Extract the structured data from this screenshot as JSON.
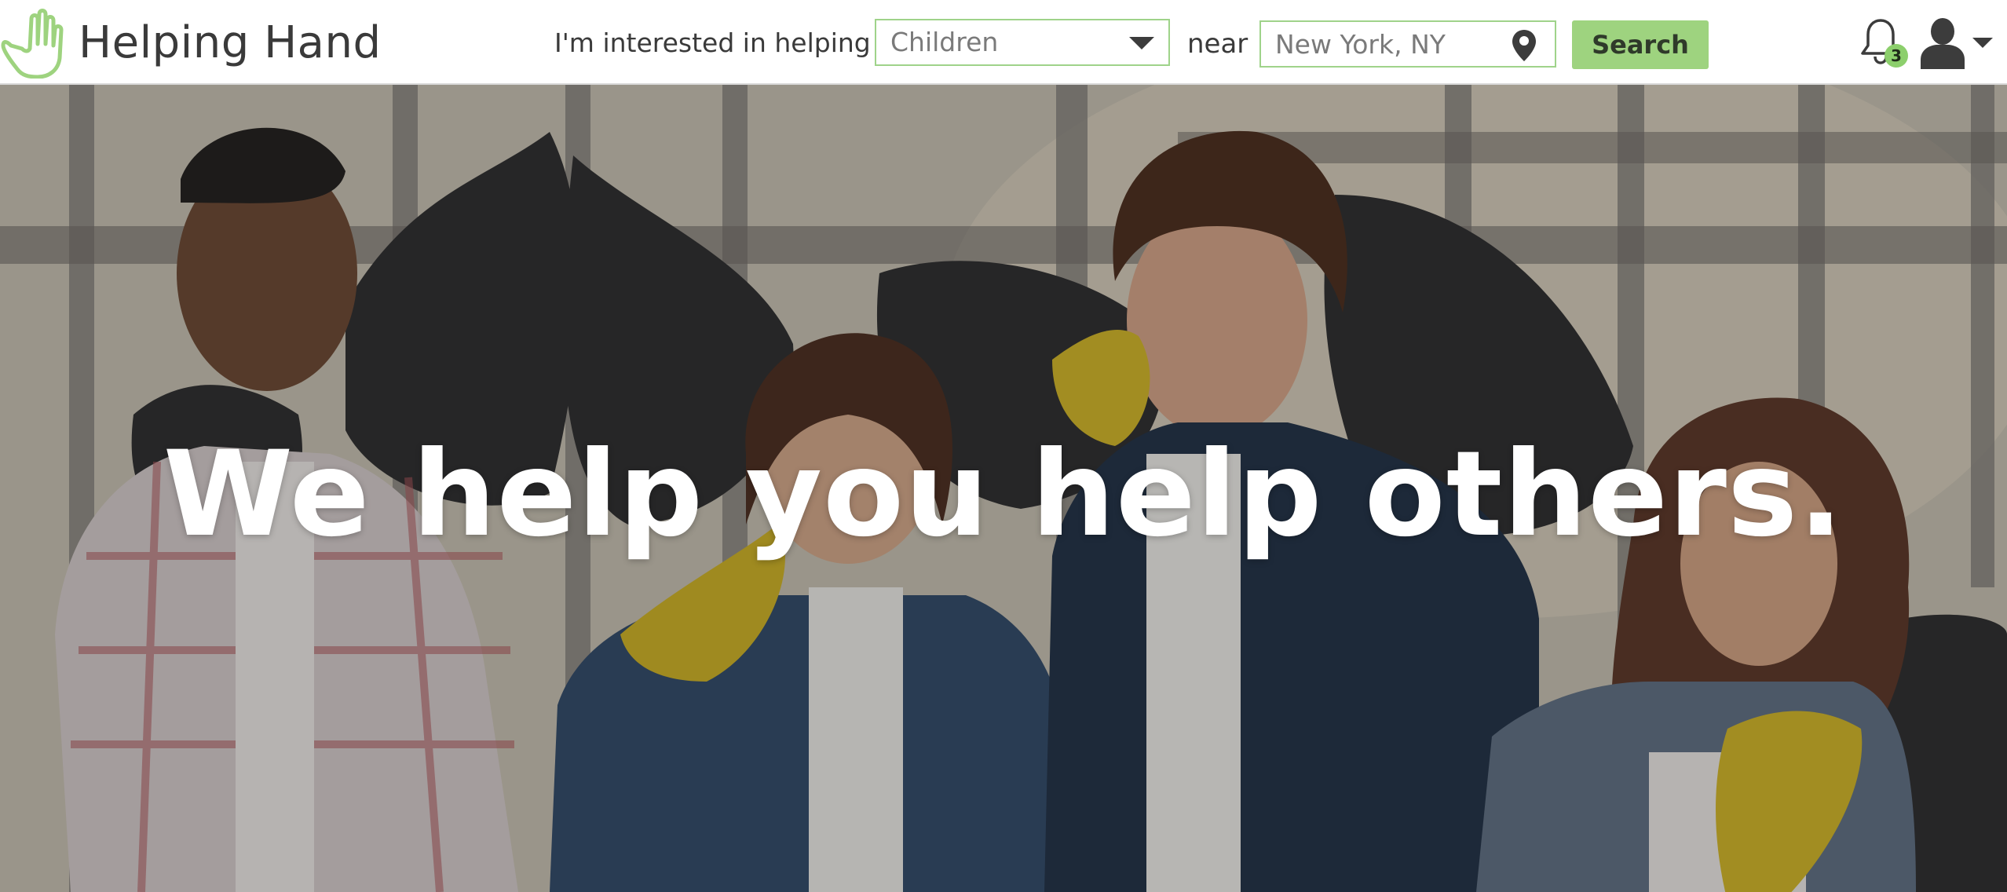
{
  "brand": {
    "name": "Helping Hand",
    "accent_color": "#9ed37f",
    "logo_icon": "hand-icon"
  },
  "search_bar": {
    "prompt_label": "I'm interested in helping",
    "cause_select": {
      "selected": "Children"
    },
    "near_label": "near",
    "location_input": {
      "value": "New York, NY",
      "icon": "map-pin-icon"
    },
    "search_button_label": "Search"
  },
  "user_menu": {
    "notifications_icon": "bell-icon",
    "notification_count": "3",
    "account_icon": "user-icon"
  },
  "hero": {
    "headline": "We help you help others."
  }
}
